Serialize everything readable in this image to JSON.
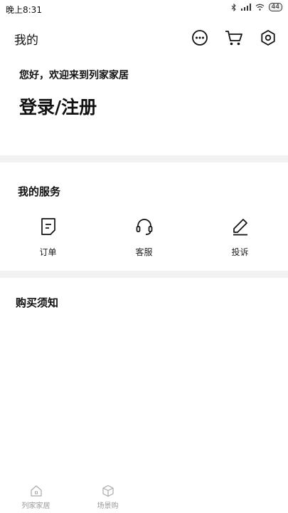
{
  "status_bar": {
    "time": "晚上8:31",
    "battery": "44"
  },
  "header": {
    "title": "我的"
  },
  "profile": {
    "greeting": "您好，欢迎来到列家家居",
    "login": "登录/注册"
  },
  "services": {
    "title": "我的服务",
    "items": [
      {
        "label": "订单",
        "icon": "document-icon"
      },
      {
        "label": "客服",
        "icon": "headset-icon"
      },
      {
        "label": "投诉",
        "icon": "pencil-icon"
      }
    ]
  },
  "notice": {
    "title": "购买须知"
  },
  "tabbar": {
    "items": [
      {
        "label": "列家家居",
        "icon": "home-icon"
      },
      {
        "label": "场景购",
        "icon": "cube-icon"
      }
    ]
  }
}
